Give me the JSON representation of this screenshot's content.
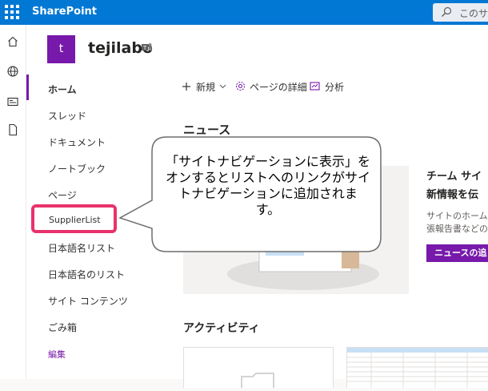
{
  "app": {
    "brand": "SharePoint",
    "search_placeholder": "このサイ"
  },
  "site": {
    "logo_letter": "t",
    "title": "tejilabo"
  },
  "nav": {
    "items": [
      {
        "label": "ホーム",
        "selected": true
      },
      {
        "label": "スレッド"
      },
      {
        "label": "ドキュメント"
      },
      {
        "label": "ノートブック"
      },
      {
        "label": "ページ"
      },
      {
        "label": "SupplierList",
        "highlighted": true
      },
      {
        "label": "日本語名リスト"
      },
      {
        "label": "日本語名のリスト"
      },
      {
        "label": "サイト コンテンツ"
      },
      {
        "label": "ごみ箱"
      }
    ],
    "edit": "編集"
  },
  "commands": {
    "new": "新規",
    "page_details": "ページの詳細",
    "analytics": "分析"
  },
  "main": {
    "news_heading": "ニュース",
    "news_side_title_1": "チーム サイ",
    "news_side_title_2": "新情報を伝",
    "news_side_sub_1": "サイトのホーム",
    "news_side_sub_2": "張報告書などの",
    "news_button": "ニュースの追",
    "activity_heading": "アクティビティ"
  },
  "callout": {
    "lines": [
      "「サイトナビゲーションに表示」を",
      "オンするとリストへのリンクがサイ",
      "トナビゲーションに追加されま",
      "す。"
    ]
  },
  "colors": {
    "suite_bar": "#0078d4",
    "site_accent": "#7719aa",
    "highlight": "#e8336d"
  }
}
